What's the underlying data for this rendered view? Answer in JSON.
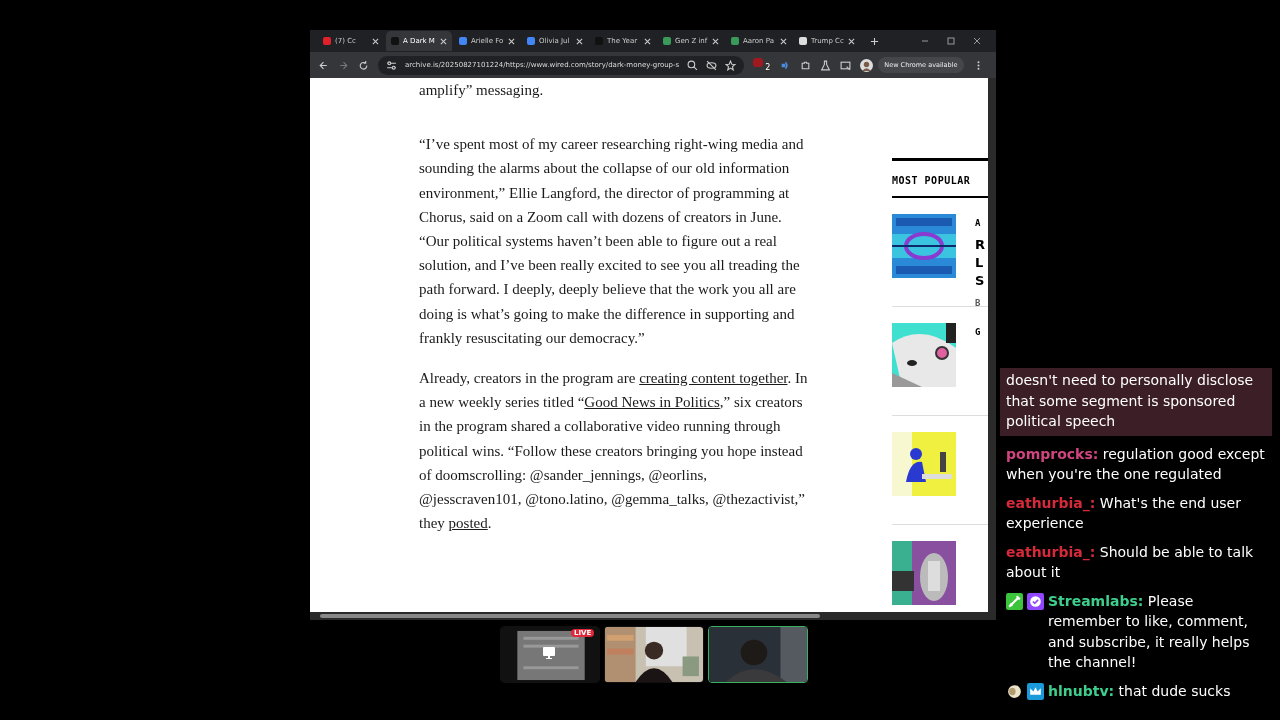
{
  "browser": {
    "tabs": [
      {
        "title": "(7) Cc",
        "color": "#e0202a",
        "selected": false
      },
      {
        "title": "A Dark M",
        "color": "#111111",
        "selected": true
      },
      {
        "title": "Arielle Fo",
        "color": "#4285f4",
        "selected": false
      },
      {
        "title": "Olivia Jul",
        "color": "#4285f4",
        "selected": false
      },
      {
        "title": "The Year",
        "color": "#111111",
        "selected": false
      },
      {
        "title": "Gen Z inf",
        "color": "#3a9a5a",
        "selected": false
      },
      {
        "title": "Aaron Pa",
        "color": "#3a9a5a",
        "selected": false
      },
      {
        "title": "Trump Cc",
        "color": "#dddddd",
        "selected": false
      }
    ],
    "address": "archive.is/20250827101224/https://www.wired.com/story/dark-money-group-s",
    "extension_badge": "2",
    "update_button": "New Chrome available"
  },
  "article": {
    "paragraphs": [
      [
        {
          "text": "amplify” messaging."
        }
      ],
      [
        {
          "text": "“I’ve spent most of my career researching right-wing media and sounding the alarms about the collapse of our old information environment,” Ellie Langford, the director of programming at Chorus, said on a Zoom call with dozens of creators in June. “Our political systems haven’t been able to figure out a real solution, and I’ve been really excited to see you all treading the path forward. I deeply, deeply believe that the work you all are doing is what’s going to make the difference in supporting and frankly resuscitating our democracy.”"
        }
      ],
      [
        {
          "text": "Already, creators in the program are "
        },
        {
          "text": "creating content together",
          "link": true
        },
        {
          "text": ". In a new weekly series titled “"
        },
        {
          "text": "Good News in Politics",
          "link": true
        },
        {
          "text": ",” six creators in the program shared a collaborative video running through political wins. “Follow these creators bringing you hope instead of doomscrolling: @sander_jennings, @eorlins, @jesscraven101, @tono.latino, @gemma_talks, @thezactivist,” they "
        },
        {
          "text": "posted",
          "link": true
        },
        {
          "text": "."
        }
      ]
    ]
  },
  "sidebar": {
    "heading": "MOST POPULAR",
    "items": [
      {
        "kind": "picture",
        "category": "A",
        "title_lines": [
          "R",
          "L",
          "S"
        ],
        "byline": "B"
      },
      {
        "kind": "picture",
        "category": "G"
      },
      {
        "kind": "picture"
      },
      {
        "kind": "picture"
      }
    ]
  },
  "chat": {
    "messages": [
      {
        "kind": "highlight",
        "text": "doesn't need to personally disclose that some segment is sponsored political speech"
      },
      {
        "kind": "user",
        "user": "pomprocks:",
        "color": "#d0457f",
        "text": "regulation good except when you're the one regulated"
      },
      {
        "kind": "user",
        "user": "eathurbia_:",
        "color": "#d62a3a",
        "text": "What's the end user experience"
      },
      {
        "kind": "user",
        "user": "eathurbia_:",
        "color": "#d62a3a",
        "text": "Should be able to talk about it"
      },
      {
        "kind": "user",
        "user": "Streamlabs:",
        "color": "#3ecf8e",
        "text": "Please remember to like, comment, and subscribe, it really helps the channel!",
        "badges": [
          {
            "kind": "sword"
          },
          {
            "kind": "verified"
          }
        ]
      },
      {
        "kind": "user",
        "user": "hlnubtv:",
        "color": "#3ecf8e",
        "text": "that dude sucks",
        "badges": [
          {
            "kind": "sheep"
          },
          {
            "kind": "crown"
          }
        ]
      }
    ]
  },
  "cameras": [
    {
      "kind": "screen",
      "badge": "LIVE",
      "selected": false
    },
    {
      "kind": "camera",
      "selected": false
    },
    {
      "kind": "camera",
      "selected": true
    }
  ]
}
